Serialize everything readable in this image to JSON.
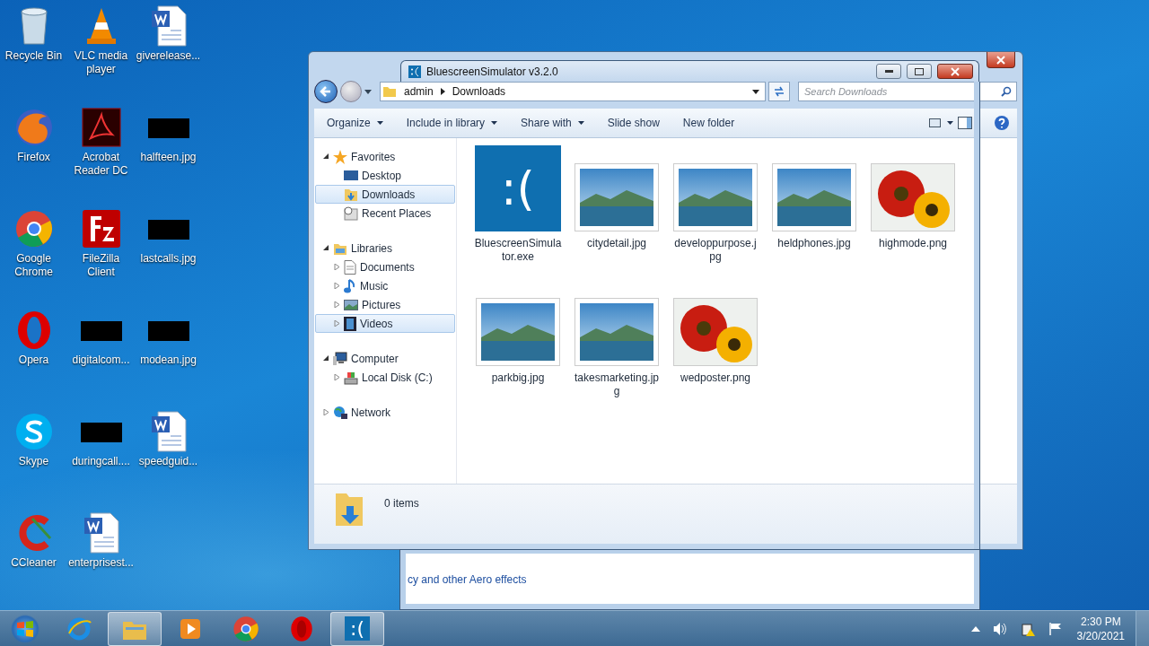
{
  "desktop_icons": [
    {
      "label": "Recycle Bin",
      "kind": "recycle"
    },
    {
      "label": "VLC media player",
      "kind": "cone"
    },
    {
      "label": "giverelease...",
      "kind": "word"
    },
    {
      "label": "Firefox",
      "kind": "fox"
    },
    {
      "label": "Acrobat Reader DC",
      "kind": "pdf"
    },
    {
      "label": "halfteen.jpg",
      "kind": "image"
    },
    {
      "label": "Google Chrome",
      "kind": "chrome"
    },
    {
      "label": "FileZilla Client",
      "kind": "ftp"
    },
    {
      "label": "lastcalls.jpg",
      "kind": "image"
    },
    {
      "label": "Opera",
      "kind": "opera"
    },
    {
      "label": "digitalcom...",
      "kind": "image"
    },
    {
      "label": "modean.jpg",
      "kind": "image"
    },
    {
      "label": "Skype",
      "kind": "skype"
    },
    {
      "label": "duringcall....",
      "kind": "image"
    },
    {
      "label": "speedguid...",
      "kind": "word"
    },
    {
      "label": "CCleaner",
      "kind": "cleaner"
    },
    {
      "label": "enterprisest...",
      "kind": "word"
    }
  ],
  "explorer": {
    "address": [
      "admin",
      "Downloads"
    ],
    "search": {
      "placeholder": "Search Downloads"
    },
    "toolbar": [
      {
        "label": "Organize",
        "dropdown": true
      },
      {
        "label": "Include in library",
        "dropdown": true
      },
      {
        "label": "Share with",
        "dropdown": true
      },
      {
        "label": "Slide show",
        "dropdown": false
      },
      {
        "label": "New folder",
        "dropdown": false
      }
    ],
    "nav": [
      {
        "label": "Favorites",
        "kind": "star",
        "expanded": true,
        "children": [
          {
            "label": "Desktop",
            "kind": "desktop",
            "selected": false
          },
          {
            "label": "Downloads",
            "kind": "folder",
            "selected": true
          },
          {
            "label": "Recent Places",
            "kind": "recent",
            "selected": false
          }
        ]
      },
      {
        "label": "Libraries",
        "kind": "library",
        "expanded": true,
        "children": [
          {
            "label": "Documents",
            "kind": "doc",
            "selected": false,
            "expanded": false
          },
          {
            "label": "Music",
            "kind": "music",
            "selected": false,
            "expanded": false
          },
          {
            "label": "Pictures",
            "kind": "pictures",
            "selected": false,
            "expanded": false
          },
          {
            "label": "Videos",
            "kind": "videos",
            "selected": true,
            "expanded": false
          }
        ]
      },
      {
        "label": "Computer",
        "kind": "computer",
        "expanded": true,
        "children": [
          {
            "label": "Local Disk (C:)",
            "kind": "disk",
            "selected": false,
            "expanded": false
          }
        ]
      },
      {
        "label": "Network",
        "kind": "network",
        "expanded": false
      }
    ],
    "files": [
      {
        "name": "BluescreenSimulator.exe",
        "kind": "exe",
        "icon_text": ":("
      },
      {
        "name": "citydetail.jpg",
        "kind": "landscape"
      },
      {
        "name": "developpurpose.jpg",
        "kind": "landscape"
      },
      {
        "name": "heldphones.jpg",
        "kind": "landscape"
      },
      {
        "name": "highmode.png",
        "kind": "flower"
      },
      {
        "name": "parkbig.jpg",
        "kind": "landscape"
      },
      {
        "name": "takesmarketing.jpg",
        "kind": "landscape"
      },
      {
        "name": "wedposter.png",
        "kind": "flower"
      }
    ],
    "status": "0 items"
  },
  "overlay": {
    "title": "BluescreenSimulator v3.2.0",
    "link": "cy and other Aero effects"
  },
  "taskbar": {
    "apps": [
      {
        "kind": "ie",
        "active": false
      },
      {
        "kind": "explorer",
        "active": true
      },
      {
        "kind": "media",
        "active": false
      },
      {
        "kind": "chrome",
        "active": false
      },
      {
        "kind": "opera",
        "active": false
      },
      {
        "kind": "bluescreen",
        "active": true,
        "glyph": ":("
      }
    ],
    "time": "2:30 PM",
    "date": "3/20/2021"
  }
}
